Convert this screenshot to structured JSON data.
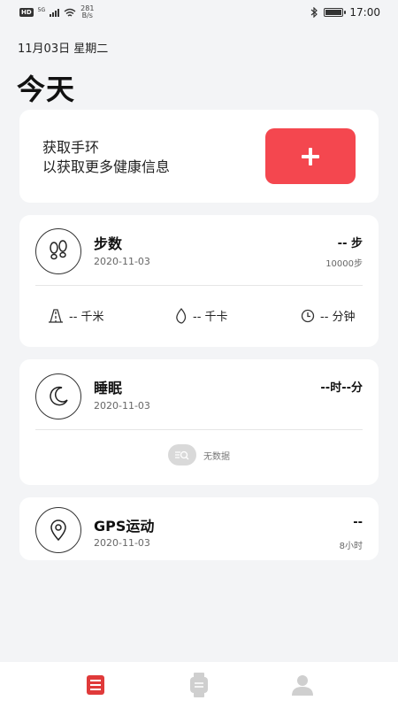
{
  "status_bar": {
    "hd": "HD",
    "signal": "5G",
    "speed_value": "281",
    "speed_unit": "B/s",
    "time": "17:00",
    "battery_level": 0.95
  },
  "header": {
    "date": "11月03日 星期二",
    "title": "今天"
  },
  "get_band": {
    "line1": "获取手环",
    "line2": "以获取更多健康信息",
    "add_icon": "plus-icon",
    "accent_color": "#f4474f"
  },
  "steps": {
    "title": "步数",
    "date": "2020-11-03",
    "value": "-- 步",
    "goal": "10000步",
    "icon": "footprints-icon",
    "metrics": [
      {
        "icon": "road-icon",
        "label": "-- 千米"
      },
      {
        "icon": "flame-icon",
        "label": "-- 千卡"
      },
      {
        "icon": "clock-icon",
        "label": "-- 分钟"
      }
    ]
  },
  "sleep": {
    "title": "睡眠",
    "date": "2020-11-03",
    "value": "--时--分",
    "icon": "moon-icon",
    "no_data": "无数据"
  },
  "gps": {
    "title": "GPS运动",
    "date": "2020-11-03",
    "value": "--",
    "goal": "8小时",
    "icon": "location-pin-icon"
  },
  "nav": {
    "items": [
      {
        "icon": "today-list-icon",
        "active": true,
        "color": "#e03a3a"
      },
      {
        "icon": "watch-icon",
        "active": false,
        "color": "#cfcfcf"
      },
      {
        "icon": "profile-icon",
        "active": false,
        "color": "#cfcfcf"
      }
    ]
  }
}
